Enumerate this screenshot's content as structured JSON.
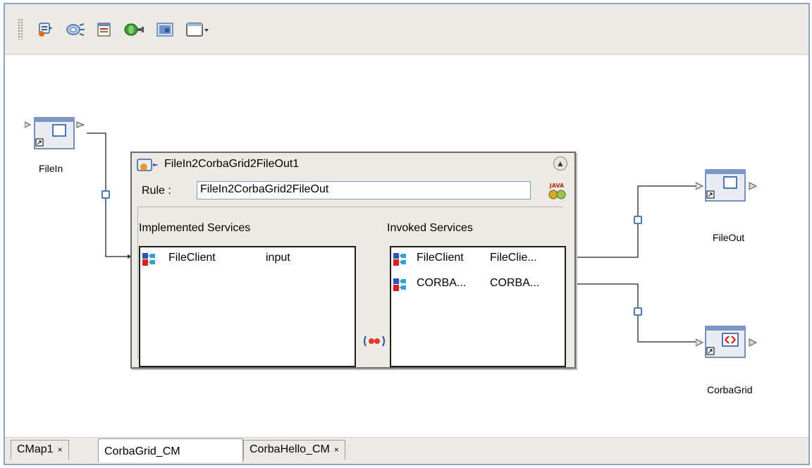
{
  "toolbar": {
    "buttons": [
      {
        "name": "new-rule-icon"
      },
      {
        "name": "transform-icon"
      },
      {
        "name": "properties-icon"
      },
      {
        "name": "connector-icon"
      },
      {
        "name": "image-icon"
      },
      {
        "name": "window-dropdown-icon"
      }
    ]
  },
  "canvas": {
    "nodes": {
      "filein": {
        "label": "FileIn"
      },
      "fileout": {
        "label": "FileOut"
      },
      "corbagrid": {
        "label": "CorbaGrid"
      }
    },
    "rule_panel": {
      "title": "FileIn2CorbaGrid2FileOut1",
      "rule_label": "Rule :",
      "rule_value": "FileIn2CorbaGrid2FileOut",
      "java_badge": "JAVA",
      "implemented_header": "Implemented Services",
      "invoked_header": "Invoked Services",
      "implemented": [
        {
          "name": "FileClient",
          "op": "input"
        }
      ],
      "invoked": [
        {
          "name": "FileClient",
          "op": "FileClie..."
        },
        {
          "name": "CORBA...",
          "op": "CORBA..."
        }
      ]
    }
  },
  "tabs": [
    {
      "label": "CMap1",
      "close": "×",
      "active": false
    },
    {
      "label": "CorbaGrid_CM",
      "close": "",
      "active": true
    },
    {
      "label": "CorbaHello_CM",
      "close": "×",
      "active": false
    }
  ],
  "colors": {
    "frame_border": "#8fa4c6",
    "toolbar_bg": "#ecebe3",
    "connector_blue": "#4f7ab1"
  }
}
